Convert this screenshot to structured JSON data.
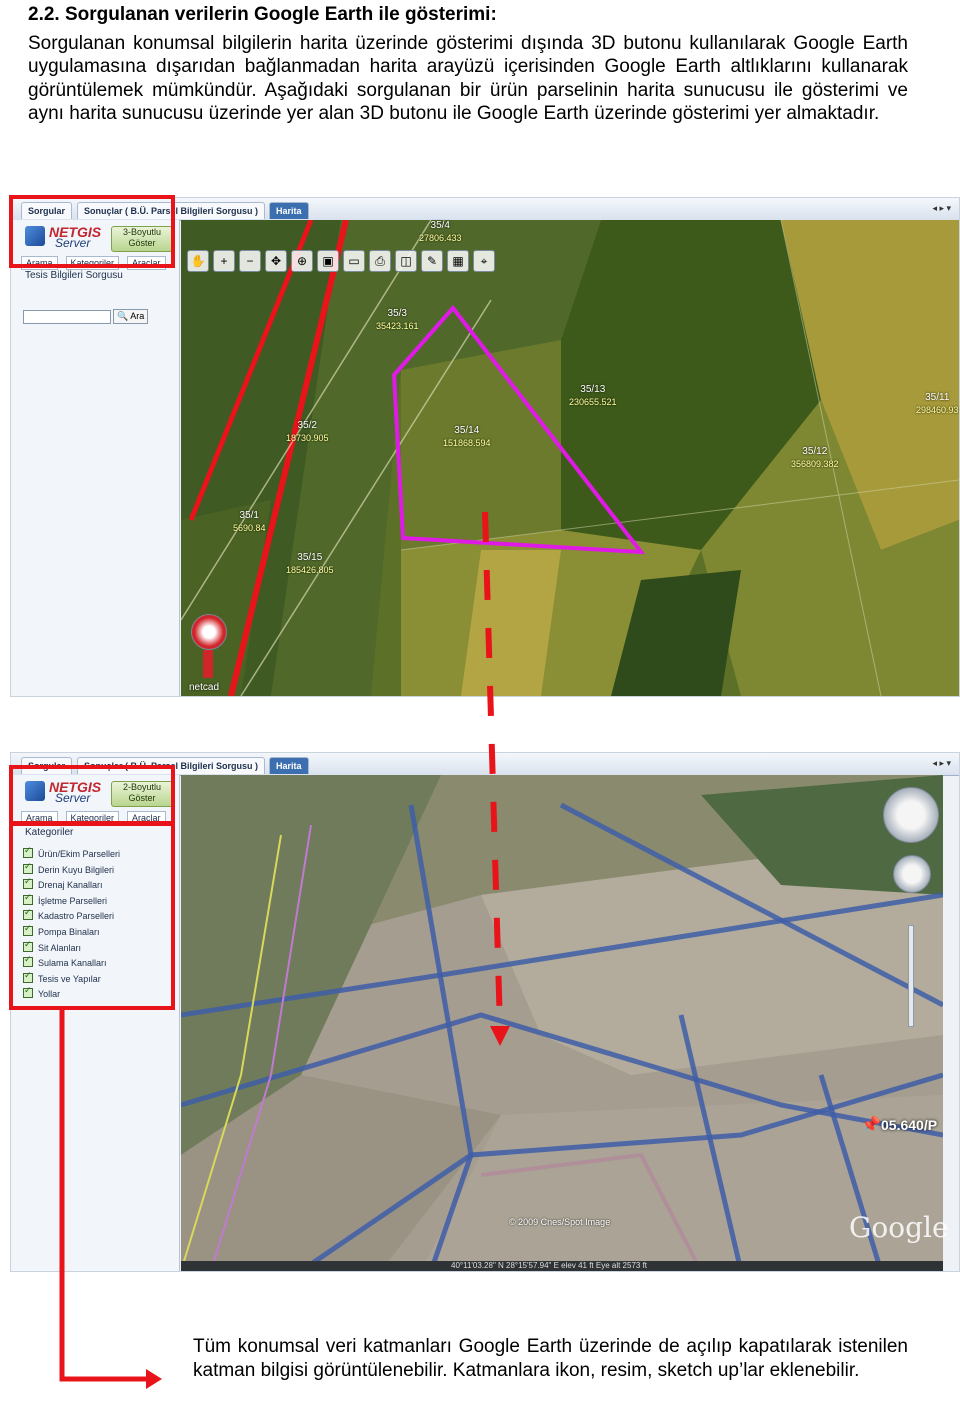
{
  "section": {
    "heading": "2.2. Sorgulanan verilerin Google Earth ile gösterimi:",
    "paragraph": "Sorgulanan konumsal bilgilerin harita üzerinde gösterimi dışında 3D butonu kullanılarak Google Earth uygulamasına dışarıdan bağlanmadan harita arayüzü içerisinden Google Earth altlıklarını kullanarak görüntülemek mümkündür. Aşağıdaki sorgulanan bir ürün parselinin harita sunucusu ile gösterimi ve aynı harita sunucusu üzerinde yer alan 3D butonu ile Google Earth üzerinde gösterimi yer almaktadır."
  },
  "screenshot1": {
    "tabs": [
      "Sorgular",
      "Sonuçlar ( B.Ü. Parsel Bilgileri Sorgusu )",
      "Harita"
    ],
    "logo": {
      "netgis": "NETGIS",
      "server": "Server",
      "button": "3-Boyutlu Göster"
    },
    "subtabs": [
      "Arama",
      "Kategoriler",
      "Araçlar"
    ],
    "panel_title": "Tesis Bilgileri Sorgusu",
    "search_button": "Ara",
    "tools": [
      "hand-icon",
      "zoom-in-icon",
      "zoom-out-icon",
      "pan-icon",
      "full-extent-icon",
      "camera-icon",
      "monitor-icon",
      "print-icon",
      "layer-icon",
      "edit-icon",
      "calculator-icon",
      "identify-icon"
    ],
    "parcels": [
      {
        "name": "35/4",
        "area": "27806.433"
      },
      {
        "name": "35/3",
        "area": "35423.161"
      },
      {
        "name": "35/13",
        "area": "230655.521"
      },
      {
        "name": "35/11",
        "area": "298460.93"
      },
      {
        "name": "35/14",
        "area": "151868.594"
      },
      {
        "name": "35/2",
        "area": "18730.905"
      },
      {
        "name": "35/12",
        "area": "356809.382"
      },
      {
        "name": "35/1",
        "area": "5690.84"
      },
      {
        "name": "35/15",
        "area": "185426.805"
      }
    ],
    "brand": "netcad"
  },
  "screenshot2": {
    "tabs": [
      "Sorgular",
      "Sonuçlar ( B.Ü. Parsel Bilgileri Sorgusu )",
      "Harita"
    ],
    "logo": {
      "netgis": "NETGIS",
      "server": "Server",
      "button": "2-Boyutlu Göster"
    },
    "subtabs": [
      "Arama",
      "Kategoriler",
      "Araçlar"
    ],
    "panel_title": "Kategoriler",
    "layers": [
      "Ürün/Ekim Parselleri",
      "Derin Kuyu Bilgileri",
      "Drenaj Kanalları",
      "İşletme Parselleri",
      "Kadastro Parselleri",
      "Pompa Binaları",
      "Sit Alanları",
      "Sulama Kanalları",
      "Tesis ve Yapılar",
      "Yollar"
    ],
    "copyright": "© 2009 Cnes/Spot Image",
    "google": "Google",
    "pin_label": "05.640/P",
    "status": "40°11'03.28\" N   28°15'57.94\" E   elev   41 ft                                               Eye alt   2573 ft"
  },
  "caption": "Tüm konumsal veri katmanları Google Earth üzerinde de açılıp kapatılarak istenilen katman bilgisi görüntülenebilir. Katmanlara ikon, resim, sketch up’lar eklenebilir.",
  "colors": {
    "annotation_red": "#e8141a",
    "parcel_highlight": "#e01ae6"
  }
}
